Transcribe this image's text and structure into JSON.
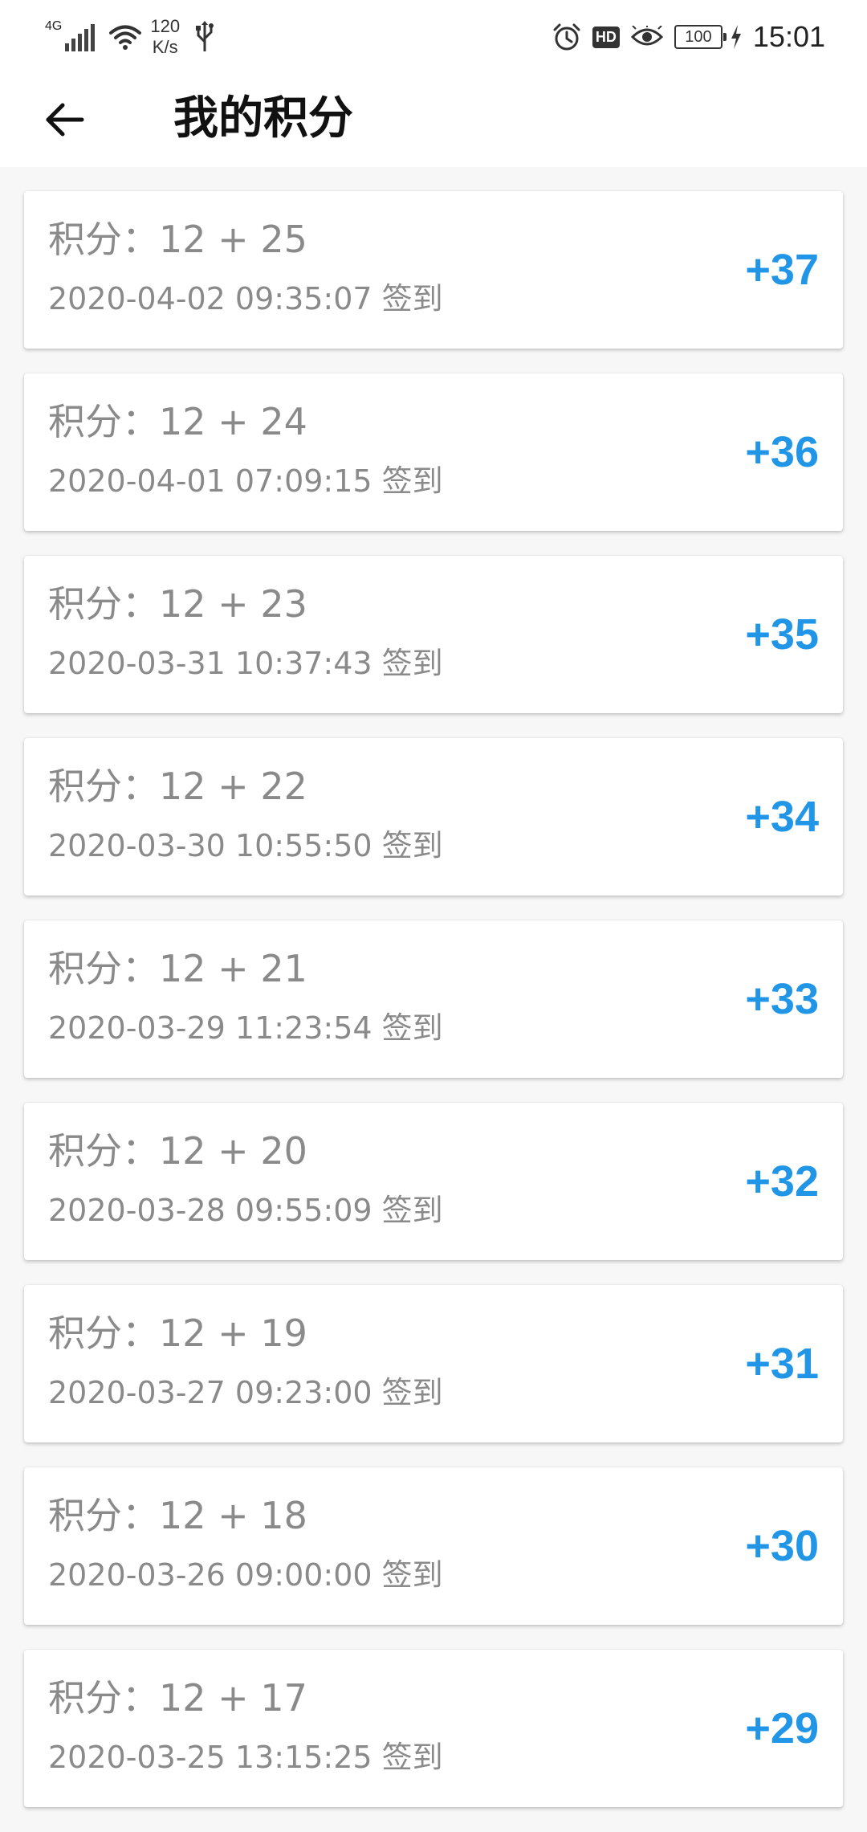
{
  "status_bar": {
    "network": "4G",
    "speed_value": "120",
    "speed_unit": "K/s",
    "hd_label": "HD",
    "battery": "100",
    "time": "15:01",
    "icons": [
      "signal-icon",
      "wifi-icon",
      "usb-icon",
      "alarm-icon",
      "hd-icon",
      "eye-icon",
      "battery-icon",
      "charging-icon"
    ]
  },
  "app_bar": {
    "title": "我的积分",
    "back_icon": "arrow-left-icon"
  },
  "colors": {
    "accent": "#2196e6",
    "secondary_text": "#8a8a8a",
    "background": "#f7f7f7"
  },
  "records": [
    {
      "points": "积分：12 + 25",
      "time": "2020-04-02 09:35:07 签到",
      "delta": "+37"
    },
    {
      "points": "积分：12 + 24",
      "time": "2020-04-01 07:09:15 签到",
      "delta": "+36"
    },
    {
      "points": "积分：12 + 23",
      "time": "2020-03-31 10:37:43 签到",
      "delta": "+35"
    },
    {
      "points": "积分：12 + 22",
      "time": "2020-03-30 10:55:50 签到",
      "delta": "+34"
    },
    {
      "points": "积分：12 + 21",
      "time": "2020-03-29 11:23:54 签到",
      "delta": "+33"
    },
    {
      "points": "积分：12 + 20",
      "time": "2020-03-28 09:55:09 签到",
      "delta": "+32"
    },
    {
      "points": "积分：12 + 19",
      "time": "2020-03-27 09:23:00 签到",
      "delta": "+31"
    },
    {
      "points": "积分：12 + 18",
      "time": "2020-03-26 09:00:00 签到",
      "delta": "+30"
    },
    {
      "points": "积分：12 + 17",
      "time": "2020-03-25 13:15:25 签到",
      "delta": "+29"
    }
  ]
}
